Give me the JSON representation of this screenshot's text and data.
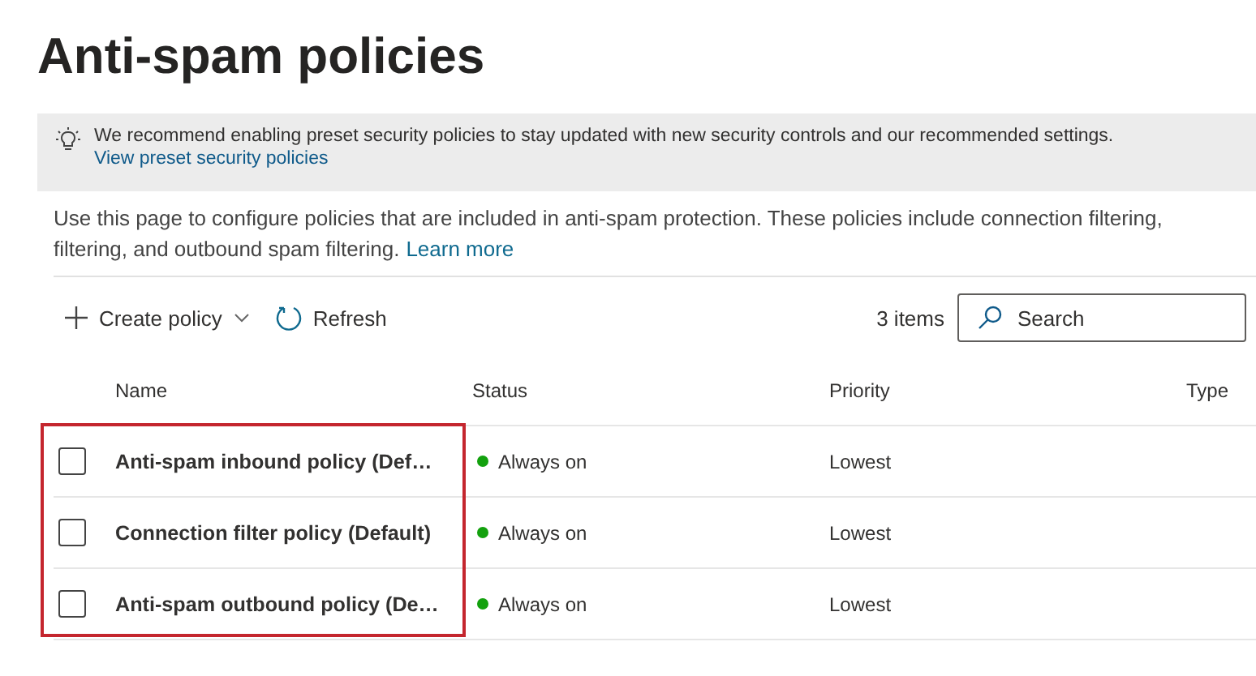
{
  "page_title": "Anti-spam policies",
  "banner": {
    "message": "We recommend enabling preset security policies to stay updated with new security controls and our recommended settings.",
    "link": "View preset security policies"
  },
  "description": {
    "line_1": "Use this page to configure policies that are included in anti-spam protection. These policies include connection filtering,",
    "line_2": "filtering, and outbound spam filtering.",
    "link": "Learn more"
  },
  "toolbar": {
    "create": "Create policy",
    "refresh": "Refresh",
    "count": "3 items",
    "search": {
      "placeholder": "Search"
    }
  },
  "table": {
    "columns": [
      "Name",
      "Status",
      "Priority",
      "Type"
    ],
    "name_column_highlighted": true,
    "rows": [
      {
        "name": "Anti-spam inbound policy (Def…",
        "checked": false,
        "status": "Always on",
        "color": "#13a10e",
        "priority": "Lowest"
      },
      {
        "name": "Connection filter policy (Default)",
        "checked": false,
        "status": "Always on",
        "color": "#13a10e",
        "priority": "Lowest"
      },
      {
        "name": "Anti-spam outbound policy (De…",
        "checked": false,
        "status": "Always on",
        "color": "#13a10e",
        "priority": "Lowest"
      }
    ]
  }
}
